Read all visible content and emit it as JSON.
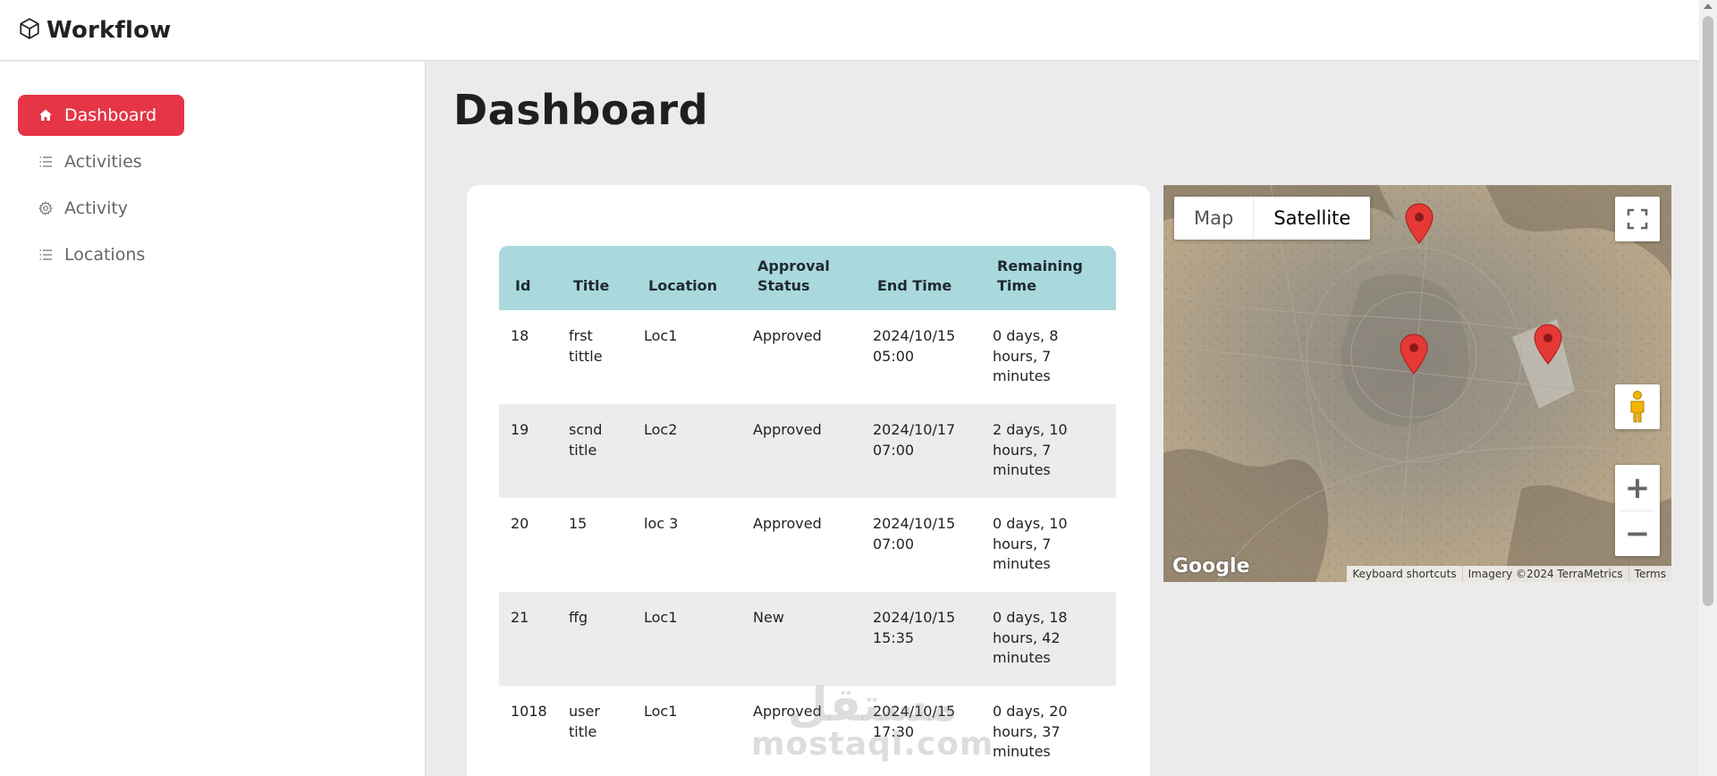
{
  "brand": {
    "name": "Workflow",
    "icon": "cube-icon"
  },
  "sidebar": {
    "items": [
      {
        "label": "Dashboard",
        "icon": "home-icon",
        "active": true
      },
      {
        "label": "Activities",
        "icon": "list-icon",
        "active": false
      },
      {
        "label": "Activity",
        "icon": "gear-icon",
        "active": false
      },
      {
        "label": "Locations",
        "icon": "list-icon",
        "active": false
      }
    ]
  },
  "page": {
    "title": "Dashboard"
  },
  "table": {
    "headers": [
      "Id",
      "Title",
      "Location",
      "Approval Status",
      "End Time",
      "Remaining Time"
    ],
    "rows": [
      [
        "18",
        "frst tittle",
        "Loc1",
        "Approved",
        "2024/10/15 05:00",
        "0 days, 8 hours, 7 minutes"
      ],
      [
        "19",
        "scnd title",
        "Loc2",
        "Approved",
        "2024/10/17 07:00",
        "2 days, 10 hours, 7 minutes"
      ],
      [
        "20",
        "15",
        "loc 3",
        "Approved",
        "2024/10/15 07:00",
        "0 days, 10 hours, 7 minutes"
      ],
      [
        "21",
        "ffg",
        "Loc1",
        "New",
        "2024/10/15 15:35",
        "0 days, 18 hours, 42 minutes"
      ],
      [
        "1018",
        "user title",
        "Loc1",
        "Approved",
        "2024/10/15 17:30",
        "0 days, 20 hours, 37 minutes"
      ]
    ]
  },
  "map": {
    "type_map": "Map",
    "type_satellite": "Satellite",
    "selected": "Satellite",
    "zoom_in": "+",
    "zoom_out": "−",
    "logo": "Google",
    "footer": [
      "Keyboard shortcuts",
      "Imagery ©2024 TerraMetrics",
      "Terms"
    ],
    "marker_color": "#e53935"
  },
  "watermark": {
    "arabic": "مستقل",
    "latin": "mostaql.com"
  },
  "colors": {
    "accent": "#e53546",
    "table_header": "#a9d9dc"
  }
}
